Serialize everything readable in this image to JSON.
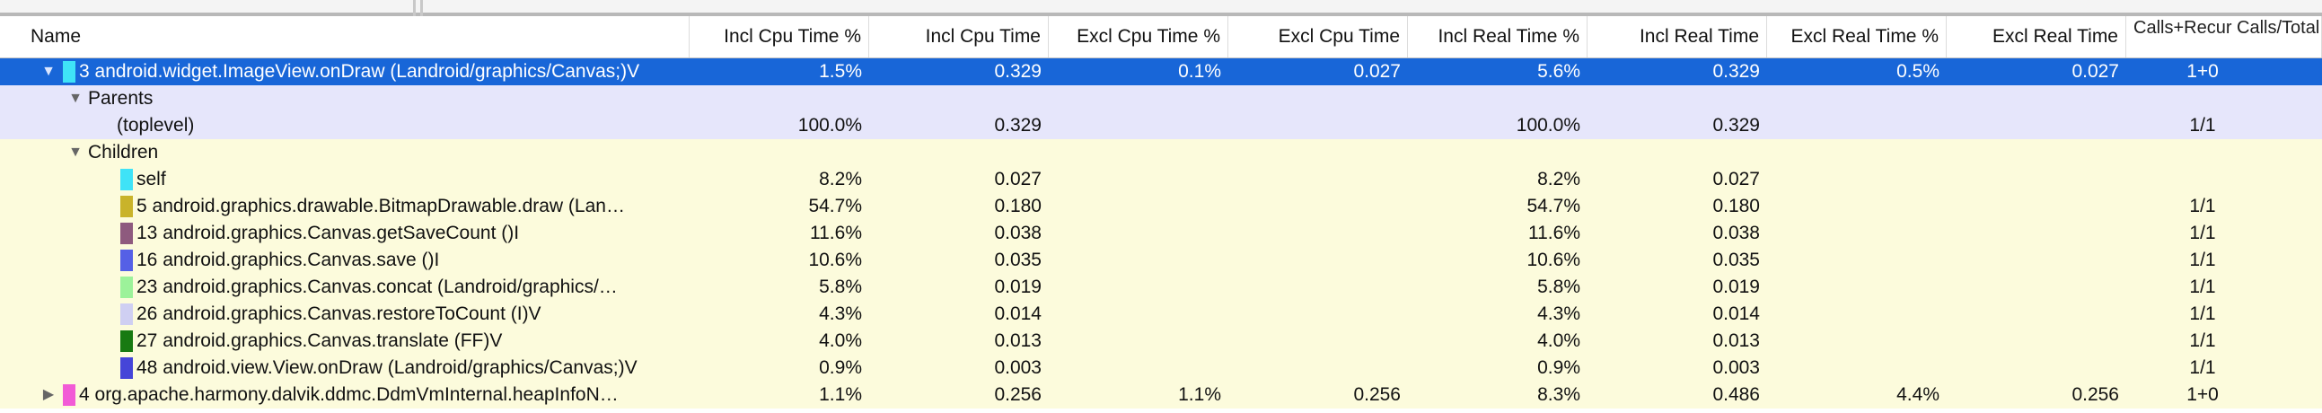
{
  "columns": [
    "Name",
    "Incl Cpu Time %",
    "Incl Cpu Time",
    "Excl Cpu Time %",
    "Excl Cpu Time",
    "Incl Real Time %",
    "Incl Real Time",
    "Excl Real Time %",
    "Excl Real Time",
    "Calls+Recur Calls/Total"
  ],
  "rows": [
    {
      "kind": "method",
      "style": "sel",
      "toggle": "▼",
      "color": "#3fe3f7",
      "name": "3 android.widget.ImageView.onDraw (Landroid/graphics/Canvas;)V",
      "incl_cpu_pct": "1.5%",
      "incl_cpu": "0.329",
      "excl_cpu_pct": "0.1%",
      "excl_cpu": "0.027",
      "incl_real_pct": "5.6%",
      "incl_real": "0.329",
      "excl_real_pct": "0.5%",
      "excl_real": "0.027",
      "calls": "1+0"
    },
    {
      "kind": "group",
      "style": "parents",
      "toggle": "▼",
      "name": "Parents"
    },
    {
      "kind": "item",
      "style": "parents",
      "name": "(toplevel)",
      "incl_cpu_pct": "100.0%",
      "incl_cpu": "0.329",
      "incl_real_pct": "100.0%",
      "incl_real": "0.329",
      "calls": "1/1"
    },
    {
      "kind": "group",
      "style": "children",
      "toggle": "▼",
      "name": "Children"
    },
    {
      "kind": "child",
      "style": "children",
      "color": "#3fe3f7",
      "name": "self",
      "incl_cpu_pct": "8.2%",
      "incl_cpu": "0.027",
      "incl_real_pct": "8.2%",
      "incl_real": "0.027",
      "calls": ""
    },
    {
      "kind": "child",
      "style": "children",
      "color": "#c9b32a",
      "name": "5 android.graphics.drawable.BitmapDrawable.draw (Lan…",
      "incl_cpu_pct": "54.7%",
      "incl_cpu": "0.180",
      "incl_real_pct": "54.7%",
      "incl_real": "0.180",
      "calls": "1/1"
    },
    {
      "kind": "child",
      "style": "children",
      "color": "#8e5a7e",
      "name": "13 android.graphics.Canvas.getSaveCount ()I",
      "incl_cpu_pct": "11.6%",
      "incl_cpu": "0.038",
      "incl_real_pct": "11.6%",
      "incl_real": "0.038",
      "calls": "1/1"
    },
    {
      "kind": "child",
      "style": "children",
      "color": "#5560e6",
      "name": "16 android.graphics.Canvas.save ()I",
      "incl_cpu_pct": "10.6%",
      "incl_cpu": "0.035",
      "incl_real_pct": "10.6%",
      "incl_real": "0.035",
      "calls": "1/1"
    },
    {
      "kind": "child",
      "style": "children",
      "color": "#9cf29a",
      "name": "23 android.graphics.Canvas.concat (Landroid/graphics/…",
      "incl_cpu_pct": "5.8%",
      "incl_cpu": "0.019",
      "incl_real_pct": "5.8%",
      "incl_real": "0.019",
      "calls": "1/1"
    },
    {
      "kind": "child",
      "style": "children",
      "color": "#cfcff2",
      "name": "26 android.graphics.Canvas.restoreToCount (I)V",
      "incl_cpu_pct": "4.3%",
      "incl_cpu": "0.014",
      "incl_real_pct": "4.3%",
      "incl_real": "0.014",
      "calls": "1/1"
    },
    {
      "kind": "child",
      "style": "children",
      "color": "#187a12",
      "name": "27 android.graphics.Canvas.translate (FF)V",
      "incl_cpu_pct": "4.0%",
      "incl_cpu": "0.013",
      "incl_real_pct": "4.0%",
      "incl_real": "0.013",
      "calls": "1/1"
    },
    {
      "kind": "child",
      "style": "children",
      "color": "#4545d8",
      "name": "48 android.view.View.onDraw (Landroid/graphics/Canvas;)V",
      "incl_cpu_pct": "0.9%",
      "incl_cpu": "0.003",
      "incl_real_pct": "0.9%",
      "incl_real": "0.003",
      "calls": "1/1"
    },
    {
      "kind": "method",
      "style": "children",
      "toggle": "▶",
      "color": "#f25bd6",
      "name": "4 org.apache.harmony.dalvik.ddmc.DdmVmInternal.heapInfoN…",
      "incl_cpu_pct": "1.1%",
      "incl_cpu": "0.256",
      "excl_cpu_pct": "1.1%",
      "excl_cpu": "0.256",
      "incl_real_pct": "8.3%",
      "incl_real": "0.486",
      "excl_real_pct": "4.4%",
      "excl_real": "0.256",
      "calls": "1+0"
    }
  ]
}
